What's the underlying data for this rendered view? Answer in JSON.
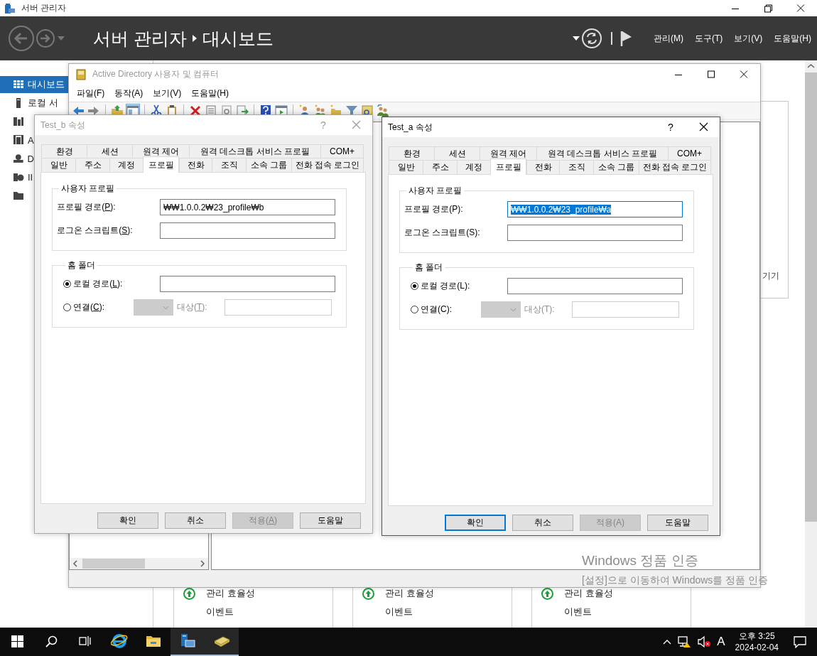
{
  "server_manager": {
    "title": "서버 관리자",
    "breadcrumb": [
      "서버 관리자",
      "대시보드"
    ],
    "menus": [
      "관리(M)",
      "도구(T)",
      "보기(V)",
      "도움말(H)"
    ],
    "sidebar": [
      {
        "kind": "dashboard",
        "label": "대시보드",
        "selected": true
      },
      {
        "kind": "server",
        "label": "로컬 서",
        "selected": false
      },
      {
        "kind": "servers",
        "selected": false
      },
      {
        "kind": "role",
        "label": "A",
        "selected": false
      },
      {
        "kind": "dns",
        "label": "D",
        "selected": false
      },
      {
        "kind": "iis",
        "label": "II",
        "selected": false
      },
      {
        "kind": "files",
        "selected": false
      }
    ],
    "tiles": [
      {
        "heading": "관리 효율성",
        "item": "이벤트"
      },
      {
        "heading": "관리 효율성",
        "item": "이벤트"
      },
      {
        "heading": "관리 효율성",
        "item": "이벤트"
      }
    ]
  },
  "side_panel": {
    "text": "기기"
  },
  "aduc": {
    "title": "Active Directory 사용자 및 컴퓨터",
    "active": false,
    "menus": [
      "파일(F)",
      "동작(A)",
      "보기(V)",
      "도움말(H)"
    ]
  },
  "dialogs": [
    {
      "title": "Test_b 속성",
      "active": false,
      "access_keys": true,
      "help": "?",
      "tab_rows": [
        [
          {
            "label": "환경",
            "selected": false
          },
          {
            "label": "세션",
            "selected": false
          },
          {
            "label": "원격 제어",
            "selected": false
          },
          {
            "label": "원격 데스크톱 서비스 프로필",
            "selected": false
          },
          {
            "label": "COM+",
            "selected": false
          }
        ],
        [
          {
            "label": "일반",
            "selected": false
          },
          {
            "label": "주소",
            "selected": false
          },
          {
            "label": "계정",
            "selected": false
          },
          {
            "label": "프로필",
            "selected": true
          },
          {
            "label": "전화",
            "selected": false
          },
          {
            "label": "조직",
            "selected": false
          },
          {
            "label": "소속 그룹",
            "selected": false
          },
          {
            "label": "전화 접속 로그인",
            "selected": false
          }
        ]
      ],
      "user_profile": {
        "legend": "사용자 프로필",
        "fields": [
          {
            "label": "프로필 경로(P):",
            "value": "₩₩1.0.0.2₩23_profile₩b",
            "focused": false
          },
          {
            "label": "로그온 스크립트(S):",
            "focused": false
          }
        ]
      },
      "home_folder": {
        "legend": "홈 폴더",
        "options": [
          {
            "kind": "local",
            "label": "로컬 경로(L):",
            "selected": true
          },
          {
            "kind": "connect",
            "label": "연결(C):",
            "selected": false,
            "disabled": true,
            "target_label": "대상(T):"
          }
        ]
      },
      "buttons": [
        {
          "label": "확인",
          "default": false,
          "disabled": false
        },
        {
          "label": "취소",
          "default": false,
          "disabled": false
        },
        {
          "label": "적용(A)",
          "default": false,
          "disabled": true
        },
        {
          "label": "도움말",
          "default": false,
          "disabled": false
        }
      ]
    },
    {
      "title": "Test_a 속성",
      "active": true,
      "access_keys": false,
      "help": "?",
      "tab_rows": [
        [
          {
            "label": "환경",
            "selected": false
          },
          {
            "label": "세션",
            "selected": false
          },
          {
            "label": "원격 제어",
            "selected": false
          },
          {
            "label": "원격 데스크톱 서비스 프로필",
            "selected": false
          },
          {
            "label": "COM+",
            "selected": false
          }
        ],
        [
          {
            "label": "일반",
            "selected": false
          },
          {
            "label": "주소",
            "selected": false
          },
          {
            "label": "계정",
            "selected": false
          },
          {
            "label": "프로필",
            "selected": true
          },
          {
            "label": "전화",
            "selected": false
          },
          {
            "label": "조직",
            "selected": false
          },
          {
            "label": "소속 그룹",
            "selected": false
          },
          {
            "label": "전화 접속 로그인",
            "selected": false
          }
        ]
      ],
      "user_profile": {
        "legend": "사용자 프로필",
        "fields": [
          {
            "label": "프로필 경로(P):",
            "value": "₩₩1.0.0.2₩23_profile₩a",
            "focused": true
          },
          {
            "label": "로그온 스크립트(S):",
            "focused": false
          }
        ]
      },
      "home_folder": {
        "legend": "홈 폴더",
        "options": [
          {
            "kind": "local",
            "label": "로컬 경로(L):",
            "selected": true
          },
          {
            "kind": "connect",
            "label": "연결(C):",
            "selected": false,
            "disabled": true,
            "target_label": "대상(T):"
          }
        ]
      },
      "buttons": [
        {
          "label": "확인",
          "default": true,
          "disabled": false
        },
        {
          "label": "취소",
          "default": false,
          "disabled": false
        },
        {
          "label": "적용(A)",
          "default": false,
          "disabled": true
        },
        {
          "label": "도움말",
          "default": false,
          "disabled": false
        }
      ]
    }
  ],
  "activation": {
    "title": "Windows 정품 인증",
    "text": "[설정]으로 이동하여 Windows를 정품 인증"
  },
  "taskbar": {
    "apps": [
      {
        "kind": "browser",
        "running": false
      },
      {
        "kind": "explorer",
        "running": false
      },
      {
        "kind": "server-manager",
        "running": true
      },
      {
        "kind": "directory",
        "running": true
      }
    ],
    "ime": "A",
    "time": "오후 3:25",
    "date": "2024-02-04"
  }
}
